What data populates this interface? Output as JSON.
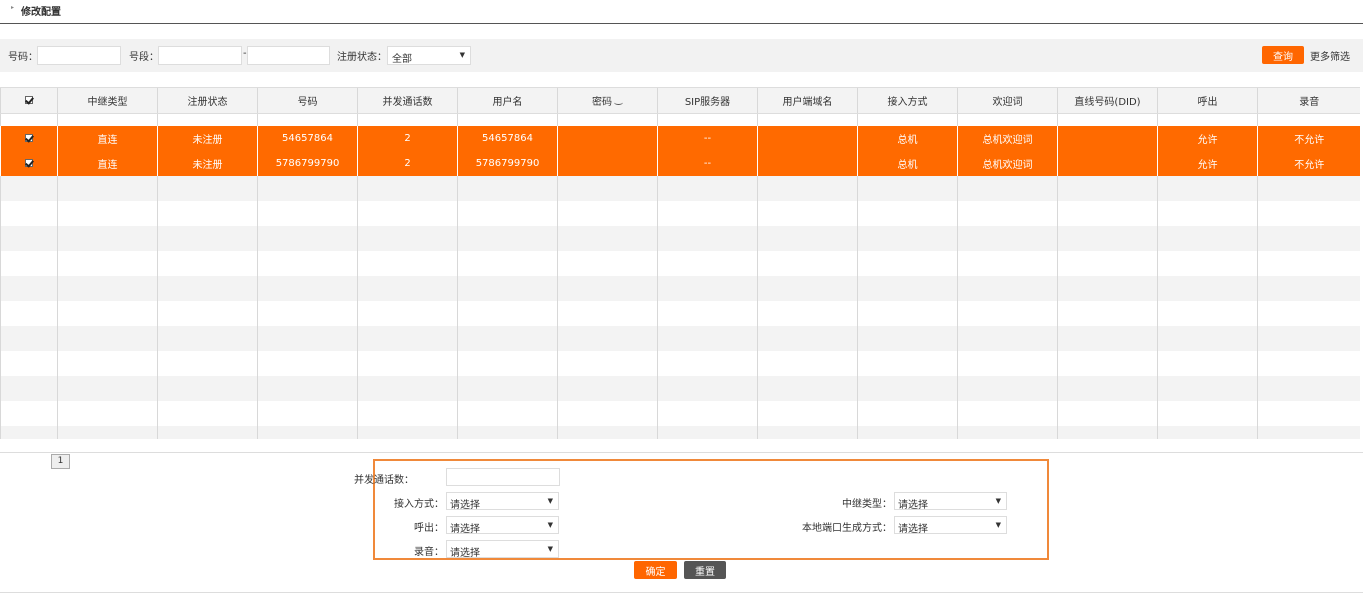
{
  "page": {
    "title": "修改配置"
  },
  "filters": {
    "number_label": "号码：",
    "number_value": "",
    "segment_label": "号段：",
    "segment_from": "",
    "segment_sep": "-",
    "segment_to": "",
    "reg_status_label": "注册状态：",
    "reg_status_value": "全部",
    "query_label": "查询",
    "more_label": "更多筛选"
  },
  "table": {
    "headers": [
      "中继类型",
      "注册状态",
      "号码",
      "并发通话数",
      "用户名",
      "密码",
      "SIP服务器",
      "用户端域名",
      "接入方式",
      "欢迎词",
      "直线号码(DID)",
      "呼出",
      "录音"
    ],
    "rows": [
      {
        "checked": true,
        "cells": [
          "直连",
          "未注册",
          "54657864",
          "2",
          "54657864",
          "",
          "--",
          "",
          "总机",
          "总机欢迎词",
          "",
          "允许",
          "不允许"
        ]
      },
      {
        "checked": true,
        "cells": [
          "直连",
          "未注册",
          "5786799790",
          "2",
          "5786799790",
          "",
          "--",
          "",
          "总机",
          "总机欢迎词",
          "",
          "允许",
          "不允许"
        ]
      }
    ]
  },
  "pagination": {
    "current": "1"
  },
  "form": {
    "concurrent_label": "并发通话数：",
    "concurrent_value": "",
    "access_label": "接入方式：",
    "access_value": "请选择",
    "trunk_type_label": "中继类型：",
    "trunk_type_value": "请选择",
    "outbound_label": "呼出：",
    "outbound_value": "请选择",
    "local_port_label": "本地端口生成方式：",
    "local_port_value": "请选择",
    "record_label": "录音：",
    "record_value": "请选择",
    "confirm_label": "确定",
    "reset_label": "重置"
  },
  "colors": {
    "accent": "#ff6600",
    "selected_row": "#ff6a00",
    "panel_border": "#f0893a",
    "reset_button": "#555555"
  },
  "icons": {
    "eye": "eye-closed-icon",
    "caret": "chevron-down-icon"
  }
}
